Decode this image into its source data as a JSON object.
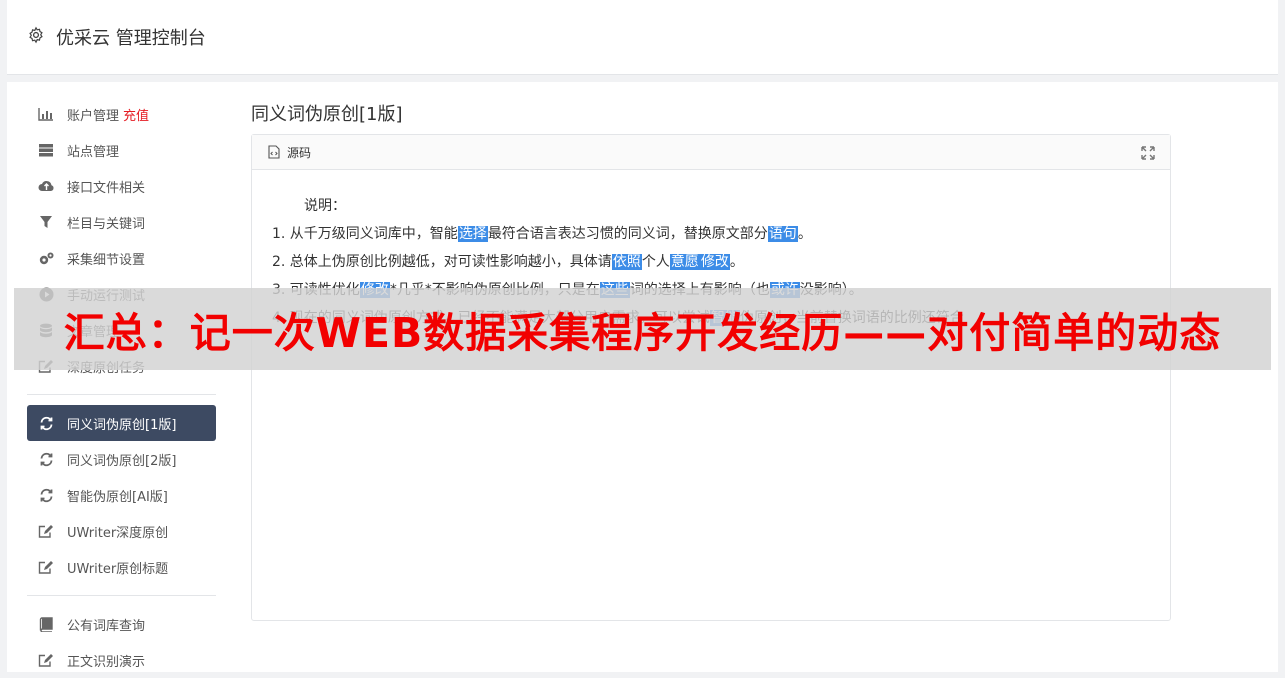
{
  "header": {
    "title": "优采云 管理控制台"
  },
  "sidebar": {
    "group1": [
      {
        "icon": "bar-chart-icon",
        "label": "账户管理",
        "badge": "充值"
      },
      {
        "icon": "server-icon",
        "label": "站点管理"
      },
      {
        "icon": "cloud-upload-icon",
        "label": "接口文件相关"
      },
      {
        "icon": "filter-icon",
        "label": "栏目与关键词"
      },
      {
        "icon": "gears-icon",
        "label": "采集细节设置"
      },
      {
        "icon": "play-icon",
        "label": "手动运行测试"
      },
      {
        "icon": "database-icon",
        "label": "文章管理"
      },
      {
        "icon": "edit-icon",
        "label": "深度原创任务"
      }
    ],
    "group2": [
      {
        "icon": "refresh-icon",
        "label": "同义词伪原创[1版]",
        "active": true
      },
      {
        "icon": "refresh-icon",
        "label": "同义词伪原创[2版]"
      },
      {
        "icon": "refresh-icon",
        "label": "智能伪原创[AI版]"
      },
      {
        "icon": "edit-icon",
        "label": "UWriter深度原创"
      },
      {
        "icon": "edit-icon",
        "label": "UWriter原创标题"
      }
    ],
    "group3": [
      {
        "icon": "book-icon",
        "label": "公有词库查询"
      },
      {
        "icon": "edit-icon",
        "label": "正文识别演示"
      }
    ]
  },
  "main": {
    "page_title": "同义词伪原创[1版]",
    "panel": {
      "label": "源码",
      "intro": "说明：",
      "lines": [
        [
          {
            "t": "1. 从千万级同义词库中，智能"
          },
          {
            "t": "选择",
            "hl": true
          },
          {
            "t": "最符合语言表达习惯的同义词，替换原文部分"
          },
          {
            "t": "语句",
            "hl": true
          },
          {
            "t": "。"
          }
        ],
        [
          {
            "t": "2. 总体上伪原创比例越低，对可读性影响越小，具体请"
          },
          {
            "t": "依照",
            "hl": true
          },
          {
            "t": "个人"
          },
          {
            "t": "意愿",
            "hl": true
          },
          {
            "t": "修改",
            "hl": true
          },
          {
            "t": "。"
          }
        ],
        [
          {
            "t": "3. 可读性优化"
          },
          {
            "t": "修改",
            "hl": true
          },
          {
            "t": "*几乎*不影响伪原创比例，只是在"
          },
          {
            "t": "这些",
            "hl": true
          },
          {
            "t": "词的选择上有影响（也"
          },
          {
            "t": "或许",
            "hl": true
          },
          {
            "t": "没影响）。"
          }
        ],
        [
          {
            "t": "4. 现在的同义词伪原创方式，已经不能满足大部分用户需求，可以尝试"
          },
          {
            "t": "智能",
            "hl": true
          },
          {
            "t": "伪原创，当前替换词语的比例还符合"
          }
        ]
      ]
    }
  },
  "banner": {
    "text": "汇总：记一次WEB数据采集程序开发经历——对付简单的动态"
  },
  "colors": {
    "active_nav_bg": "#3d4a62",
    "highlight": "#3c8ce7",
    "banner_text": "#f20000",
    "badge": "#e51c23"
  }
}
